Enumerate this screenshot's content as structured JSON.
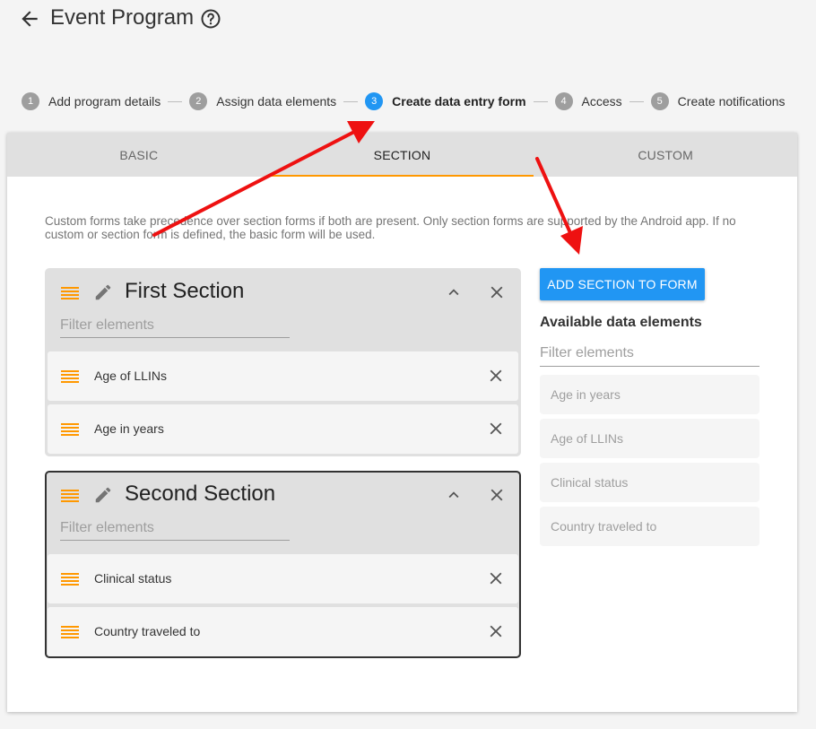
{
  "header": {
    "title": "Event Program"
  },
  "stepper": {
    "steps": [
      {
        "number": "1",
        "label": "Add program details",
        "active": false
      },
      {
        "number": "2",
        "label": "Assign data elements",
        "active": false
      },
      {
        "number": "3",
        "label": "Create data entry form",
        "active": true
      },
      {
        "number": "4",
        "label": "Access",
        "active": false
      },
      {
        "number": "5",
        "label": "Create notifications",
        "active": false
      }
    ]
  },
  "tabs": [
    {
      "label": "BASIC",
      "active": false
    },
    {
      "label": "SECTION",
      "active": true
    },
    {
      "label": "CUSTOM",
      "active": false
    }
  ],
  "info_text": "Custom forms take precedence over section forms if both are present. Only section forms are supported by the Android app. If no custom or section form is defined, the basic form will be used.",
  "sections": [
    {
      "title": "First Section",
      "filter_placeholder": "Filter elements",
      "elements": [
        "Age of LLINs",
        "Age in years"
      ]
    },
    {
      "title": "Second Section",
      "filter_placeholder": "Filter elements",
      "elements": [
        "Clinical status",
        "Country traveled to"
      ]
    }
  ],
  "sidebar": {
    "add_button_label": "ADD SECTION TO FORM",
    "heading": "Available data elements",
    "filter_placeholder": "Filter elements",
    "items": [
      "Age in years",
      "Age of LLINs",
      "Clinical status",
      "Country traveled to"
    ]
  },
  "colors": {
    "accent_blue": "#2196f3",
    "tab_indicator_orange": "#ff9800",
    "drag_handle_orange": "#ff9800",
    "annotation_red": "#ee1111"
  },
  "icons": {
    "back": "arrow-back-icon",
    "help": "help-circle-icon",
    "drag": "drag-handle-icon",
    "edit": "pencil-icon",
    "collapse": "chevron-up-icon",
    "close": "close-icon"
  }
}
